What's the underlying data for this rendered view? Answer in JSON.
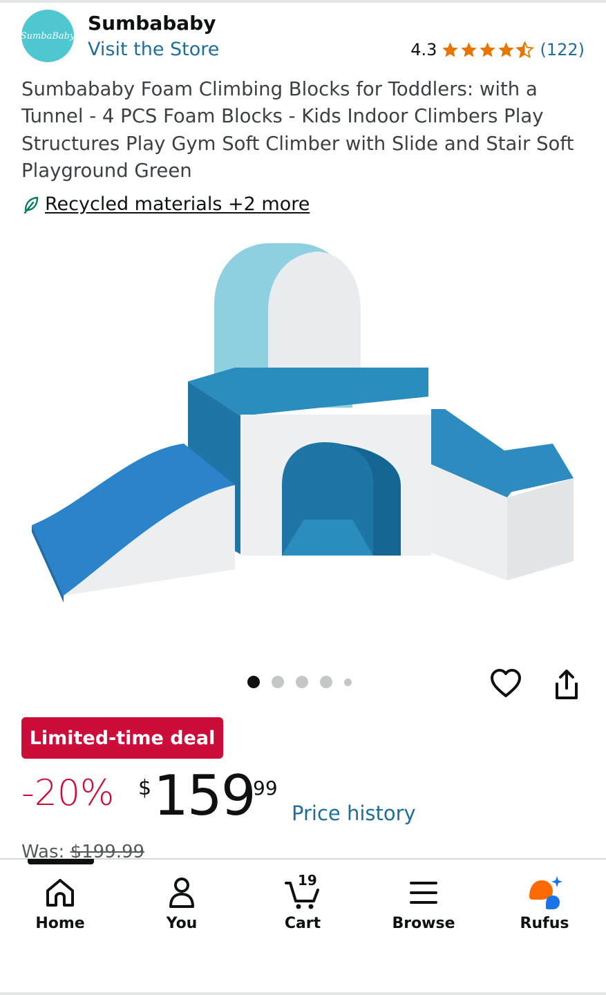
{
  "brand": {
    "logo_text": "SumbaBaby",
    "name": "Sumbababy",
    "visit_store": "Visit the Store"
  },
  "rating": {
    "value": "4.3",
    "stars": 4.3,
    "count": "(122)",
    "star_color": "#e77600"
  },
  "product": {
    "title": "Sumbababy Foam Climbing Blocks for Toddlers: with a Tunnel - 4 PCS Foam Blocks - Kids Indoor Climbers Play Structures Play Gym Soft Climber with Slide and Stair Soft Playground Green",
    "eco_link": "Recycled materials +2 more"
  },
  "carousel": {
    "total": 5,
    "active_index": 0
  },
  "deal": {
    "badge": "Limited-time deal",
    "badge_color": "#cc0c39"
  },
  "price": {
    "discount": "-20%",
    "symbol": "$",
    "whole": "159",
    "fraction": "99",
    "history_link": "Price history",
    "was_label": "Was:",
    "was_price": "$199.99"
  },
  "nav": {
    "items": [
      {
        "label": "Home",
        "icon": "home-icon"
      },
      {
        "label": "You",
        "icon": "person-icon"
      },
      {
        "label": "Cart",
        "icon": "cart-icon",
        "badge": "19"
      },
      {
        "label": "Browse",
        "icon": "menu-icon"
      },
      {
        "label": "Rufus",
        "icon": "rufus-icon"
      }
    ],
    "active": "Home"
  },
  "colors": {
    "link": "#1f6e9a",
    "deal_red": "#cc0c39",
    "text": "#0f1111"
  }
}
